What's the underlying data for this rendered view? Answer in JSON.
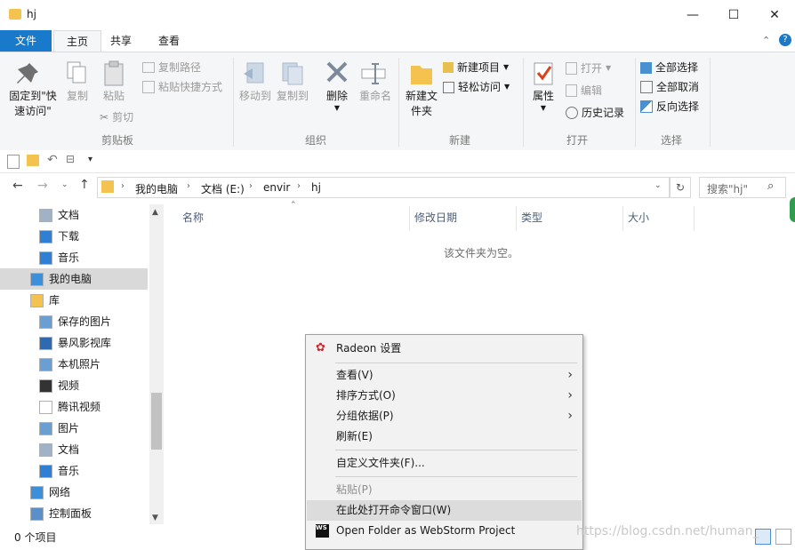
{
  "window": {
    "title": "hj",
    "minimize": "—",
    "maximize": "☐",
    "close": "✕"
  },
  "tabs": {
    "file": "文件",
    "home": "主页",
    "share": "共享",
    "view": "查看"
  },
  "ribbon": {
    "clipboard": {
      "pin_label": "固定到\"快速访问\"",
      "copy_label": "复制",
      "paste_label": "粘贴",
      "copy_path": "复制路径",
      "paste_shortcut": "粘贴快捷方式",
      "cut": "剪切",
      "group": "剪贴板"
    },
    "organize": {
      "move_to": "移动到",
      "copy_to": "复制到",
      "delete": "删除",
      "rename": "重命名",
      "group": "组织"
    },
    "new": {
      "new_folder": "新建文件夹",
      "new_item": "新建项目",
      "easy_access": "轻松访问",
      "group": "新建"
    },
    "open": {
      "properties": "属性",
      "open": "打开",
      "edit": "编辑",
      "history": "历史记录",
      "group": "打开"
    },
    "select": {
      "select_all": "全部选择",
      "select_none": "全部取消",
      "invert": "反向选择",
      "group": "选择"
    }
  },
  "address": {
    "segments": [
      "我的电脑",
      "文档 (E:)",
      "envir",
      "hj"
    ],
    "search_placeholder": "搜索\"hj\""
  },
  "nav": [
    {
      "label": "文档",
      "icon": "document-icon",
      "indent": 1
    },
    {
      "label": "下载",
      "icon": "download-arrow-icon",
      "indent": 1
    },
    {
      "label": "音乐",
      "icon": "music-note-icon",
      "indent": 1
    },
    {
      "label": "我的电脑",
      "icon": "computer-icon",
      "indent": 0,
      "selected": true
    },
    {
      "label": "库",
      "icon": "library-icon",
      "indent": 0
    },
    {
      "label": "保存的图片",
      "icon": "picture-icon",
      "indent": 1
    },
    {
      "label": "暴风影视库",
      "icon": "video-library-icon",
      "indent": 1
    },
    {
      "label": "本机照片",
      "icon": "photo-icon",
      "indent": 1
    },
    {
      "label": "视频",
      "icon": "film-icon",
      "indent": 1
    },
    {
      "label": "腾讯视频",
      "icon": "file-icon",
      "indent": 1
    },
    {
      "label": "图片",
      "icon": "picture-icon",
      "indent": 1
    },
    {
      "label": "文档",
      "icon": "document-icon",
      "indent": 1
    },
    {
      "label": "音乐",
      "icon": "music-note-icon",
      "indent": 1
    },
    {
      "label": "网络",
      "icon": "network-icon",
      "indent": 0
    },
    {
      "label": "控制面板",
      "icon": "control-panel-icon",
      "indent": 0
    }
  ],
  "columns": {
    "name": "名称",
    "modified": "修改日期",
    "type": "类型",
    "size": "大小"
  },
  "content": {
    "empty_message": "该文件夹为空。"
  },
  "status": {
    "items": "0 个项目"
  },
  "context_menu": {
    "radeon": "Radeon 设置",
    "view": "查看(V)",
    "sort": "排序方式(O)",
    "group": "分组依据(P)",
    "refresh": "刷新(E)",
    "customize": "自定义文件夹(F)...",
    "paste": "粘贴(P)",
    "open_cmd": "在此处打开命令窗口(W)",
    "webstorm": "Open Folder as WebStorm Project"
  },
  "watermark": "https://blog.csdn.net/human_"
}
